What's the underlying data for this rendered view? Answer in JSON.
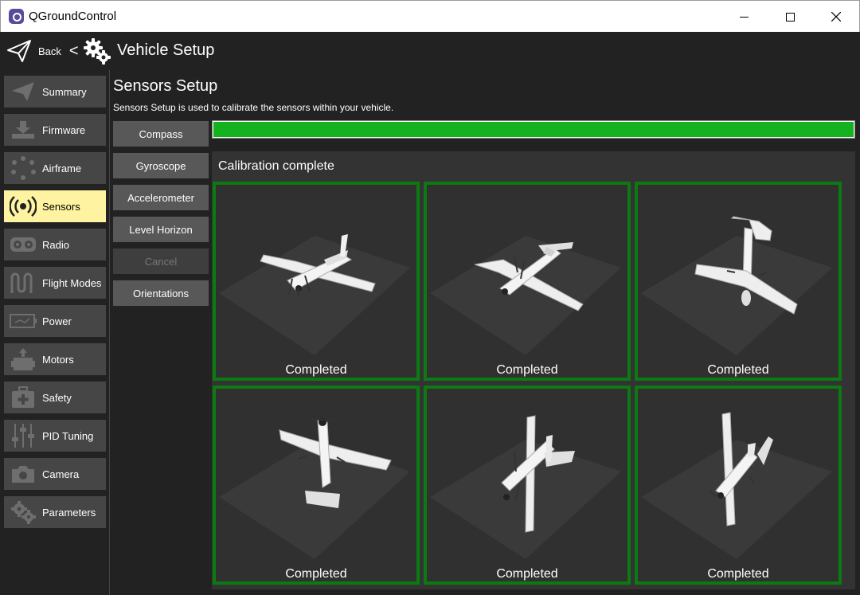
{
  "window": {
    "title": "QGroundControl"
  },
  "toolbar": {
    "back_label": "Back",
    "separator": "<",
    "title": "Vehicle Setup"
  },
  "sidebar": {
    "items": [
      {
        "label": "Summary",
        "icon": "paper-plane-icon"
      },
      {
        "label": "Firmware",
        "icon": "download-icon"
      },
      {
        "label": "Airframe",
        "icon": "airframe-dots-icon"
      },
      {
        "label": "Sensors",
        "icon": "sensor-waves-icon",
        "active": true
      },
      {
        "label": "Radio",
        "icon": "radio-icon"
      },
      {
        "label": "Flight Modes",
        "icon": "wave-icon"
      },
      {
        "label": "Power",
        "icon": "battery-icon"
      },
      {
        "label": "Motors",
        "icon": "motor-icon"
      },
      {
        "label": "Safety",
        "icon": "first-aid-icon"
      },
      {
        "label": "PID Tuning",
        "icon": "sliders-icon"
      },
      {
        "label": "Camera",
        "icon": "camera-icon"
      },
      {
        "label": "Parameters",
        "icon": "gears-icon"
      }
    ]
  },
  "main": {
    "title": "Sensors Setup",
    "description": "Sensors Setup is used to calibrate the sensors within your vehicle.",
    "buttons": [
      {
        "label": "Compass"
      },
      {
        "label": "Gyroscope"
      },
      {
        "label": "Accelerometer"
      },
      {
        "label": "Level Horizon"
      },
      {
        "label": "Cancel",
        "disabled": true
      },
      {
        "label": "Orientations"
      }
    ],
    "progress": 1.0,
    "calibration_title": "Calibration complete",
    "tiles": [
      {
        "status": "Completed"
      },
      {
        "status": "Completed"
      },
      {
        "status": "Completed"
      },
      {
        "status": "Completed"
      },
      {
        "status": "Completed"
      },
      {
        "status": "Completed"
      }
    ]
  },
  "colors": {
    "accent_active": "#fef3a0",
    "progress_green": "#14b21e",
    "tile_border": "#0c7a12"
  }
}
